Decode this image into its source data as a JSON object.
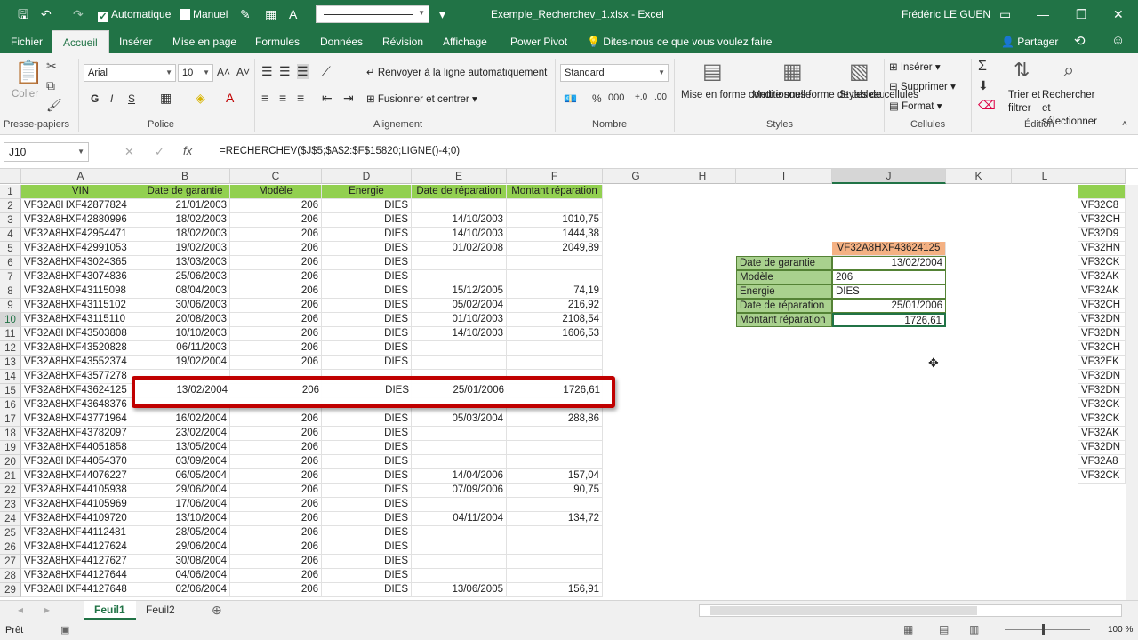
{
  "titlebar": {
    "autosave_label": "Automatique",
    "manual_label": "Manuel",
    "filename": "Exemple_Recherchev_1.xlsx  -  Excel",
    "user": "Frédéric LE GUEN"
  },
  "menu": {
    "tabs": [
      "Fichier",
      "Accueil",
      "Insérer",
      "Mise en page",
      "Formules",
      "Données",
      "Révision",
      "Affichage",
      "Power Pivot"
    ],
    "tell_me": "Dites-nous ce que vous voulez faire",
    "share": "Partager"
  },
  "ribbon": {
    "paste": "Coller",
    "clipboard_group": "Presse-papiers",
    "font_name": "Arial",
    "font_size": "10",
    "font_group": "Police",
    "bold": "G",
    "italic": "I",
    "underline": "S",
    "wrap_text": "Renvoyer à la ligne automatiquement",
    "merge_center": "Fusionner et centrer",
    "alignment_group": "Alignement",
    "number_format": "Standard",
    "number_group": "Nombre",
    "cond_format": "Mise en forme conditionnelle",
    "format_table": "Mettre sous forme de tableau",
    "cell_styles": "Styles de cellules",
    "styles_group": "Styles",
    "insert": "Insérer",
    "delete": "Supprimer",
    "format": "Format",
    "cells_group": "Cellules",
    "sort_filter": "Trier et filtrer",
    "find_select": "Rechercher et sélectionner",
    "edit_group": "Édition"
  },
  "formula_bar": {
    "name_box": "J10",
    "formula": "=RECHERCHEV($J$5;$A$2:$F$15820;LIGNE()-4;0)"
  },
  "columns": [
    "A",
    "B",
    "C",
    "D",
    "E",
    "F",
    "G",
    "H",
    "I",
    "J",
    "K",
    "L"
  ],
  "headers": [
    "VIN",
    "Date de garantie",
    "Modèle",
    "Energie",
    "Date de réparation",
    "Montant réparation"
  ],
  "rows": [
    [
      "VF32A8HXF42877824",
      "21/01/2003",
      "206",
      "DIES",
      "",
      ""
    ],
    [
      "VF32A8HXF42880996",
      "18/02/2003",
      "206",
      "DIES",
      "14/10/2003",
      "1010,75"
    ],
    [
      "VF32A8HXF42954471",
      "18/02/2003",
      "206",
      "DIES",
      "14/10/2003",
      "1444,38"
    ],
    [
      "VF32A8HXF42991053",
      "19/02/2003",
      "206",
      "DIES",
      "01/02/2008",
      "2049,89"
    ],
    [
      "VF32A8HXF43024365",
      "13/03/2003",
      "206",
      "DIES",
      "",
      ""
    ],
    [
      "VF32A8HXF43074836",
      "25/06/2003",
      "206",
      "DIES",
      "",
      ""
    ],
    [
      "VF32A8HXF43115098",
      "08/04/2003",
      "206",
      "DIES",
      "15/12/2005",
      "74,19"
    ],
    [
      "VF32A8HXF43115102",
      "30/06/2003",
      "206",
      "DIES",
      "05/02/2004",
      "216,92"
    ],
    [
      "VF32A8HXF43115110",
      "20/08/2003",
      "206",
      "DIES",
      "01/10/2003",
      "2108,54"
    ],
    [
      "VF32A8HXF43503808",
      "10/10/2003",
      "206",
      "DIES",
      "14/10/2003",
      "1606,53"
    ],
    [
      "VF32A8HXF43520828",
      "06/11/2003",
      "206",
      "DIES",
      "",
      ""
    ],
    [
      "VF32A8HXF43552374",
      "19/02/2004",
      "206",
      "DIES",
      "",
      ""
    ],
    [
      "VF32A8HXF43577278",
      "",
      "",
      "",
      "",
      ""
    ],
    [
      "VF32A8HXF43624125",
      "",
      "",
      "",
      "",
      ""
    ],
    [
      "VF32A8HXF43648376",
      "",
      "",
      "",
      "",
      ""
    ],
    [
      "VF32A8HXF43771964",
      "16/02/2004",
      "206",
      "DIES",
      "05/03/2004",
      "288,86"
    ],
    [
      "VF32A8HXF43782097",
      "23/02/2004",
      "206",
      "DIES",
      "",
      ""
    ],
    [
      "VF32A8HXF44051858",
      "13/05/2004",
      "206",
      "DIES",
      "",
      ""
    ],
    [
      "VF32A8HXF44054370",
      "03/09/2004",
      "206",
      "DIES",
      "",
      ""
    ],
    [
      "VF32A8HXF44076227",
      "06/05/2004",
      "206",
      "DIES",
      "14/04/2006",
      "157,04"
    ],
    [
      "VF32A8HXF44105938",
      "29/06/2004",
      "206",
      "DIES",
      "07/09/2006",
      "90,75"
    ],
    [
      "VF32A8HXF44105969",
      "17/06/2004",
      "206",
      "DIES",
      "",
      ""
    ],
    [
      "VF32A8HXF44109720",
      "13/10/2004",
      "206",
      "DIES",
      "04/11/2004",
      "134,72"
    ],
    [
      "VF32A8HXF44112481",
      "28/05/2004",
      "206",
      "DIES",
      "",
      ""
    ],
    [
      "VF32A8HXF44127624",
      "29/06/2004",
      "206",
      "DIES",
      "",
      ""
    ],
    [
      "VF32A8HXF44127627",
      "30/08/2004",
      "206",
      "DIES",
      "",
      ""
    ],
    [
      "VF32A8HXF44127644",
      "04/06/2004",
      "206",
      "DIES",
      "",
      ""
    ],
    [
      "VF32A8HXF44127648",
      "02/06/2004",
      "206",
      "DIES",
      "13/06/2005",
      "156,91"
    ]
  ],
  "highlight_row": [
    "13/02/2004",
    "206",
    "DIES",
    "25/01/2006",
    "1726,61"
  ],
  "lookup": {
    "vin": "VF32A8HXF43624125",
    "labels": [
      "Date de garantie",
      "Modèle",
      "Energie",
      "Date de réparation",
      "Montant réparation"
    ],
    "values": [
      "13/02/2004",
      "206",
      "DIES",
      "25/01/2006",
      "1726,61"
    ]
  },
  "right_pane": [
    "VF32C8",
    "VF32CH",
    "VF32D9",
    "VF32HN",
    "VF32CK",
    "VF32AK",
    "VF32AK",
    "VF32CH",
    "VF32DN",
    "VF32DN",
    "VF32CH",
    "VF32EK",
    "VF32DN",
    "VF32DN",
    "VF32CK",
    "VF32CK",
    "VF32AK",
    "VF32DN",
    "VF32A8",
    "VF32CK"
  ],
  "sheets": [
    "Feuil1",
    "Feuil2"
  ],
  "status": {
    "ready": "Prêt",
    "zoom": "100 %"
  },
  "colors": {
    "excel_green": "#217346",
    "header_fill": "#92d050",
    "lookup_label_fill": "#a9d18e",
    "vin_fill": "#f4b183",
    "highlight_border": "#c00000"
  }
}
